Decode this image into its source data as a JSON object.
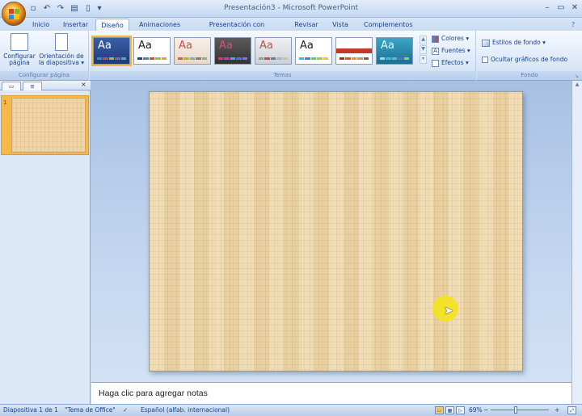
{
  "window": {
    "title": "Presentación3 - Microsoft PowerPoint",
    "min": "–",
    "max": "▭",
    "close": "✕"
  },
  "qat": {
    "icons": [
      "save-icon",
      "undo-icon",
      "redo-icon",
      "open-icon",
      "new-icon"
    ],
    "glyphs": [
      "💾",
      "↶",
      "↷",
      "📂",
      "📄"
    ]
  },
  "tabs": [
    "Inicio",
    "Insertar",
    "Diseño",
    "Animaciones",
    "Presentación con diapositivas",
    "Revisar",
    "Vista",
    "Complementos"
  ],
  "active_tab": "Diseño",
  "ribbon": {
    "page_setup": {
      "btn1": [
        "Configurar",
        "página"
      ],
      "btn2": [
        "Orientación de",
        "la diapositiva ▾"
      ],
      "label": "Configurar página"
    },
    "themes": {
      "label": "Temas",
      "aa": "Aa",
      "colors": "Colores ▾",
      "fonts": "Fuentes ▾",
      "effects": "Efectos ▾"
    },
    "background": {
      "styles": "Estilos de fondo ▾",
      "hide": "Ocultar gráficos de fondo",
      "label": "Fondo"
    }
  },
  "notes_placeholder": "Haga clic para agregar notas",
  "slide_number": "1",
  "status": {
    "slide": "Diapositiva 1 de 1",
    "theme": "\"Tema de Office\"",
    "language": "Español (alfab. internacional)",
    "zoom": "69%",
    "zoom_out": "−",
    "zoom_in": "+"
  },
  "colors": {
    "accent": "#f2b544",
    "ribbon_text": "#15428b"
  }
}
